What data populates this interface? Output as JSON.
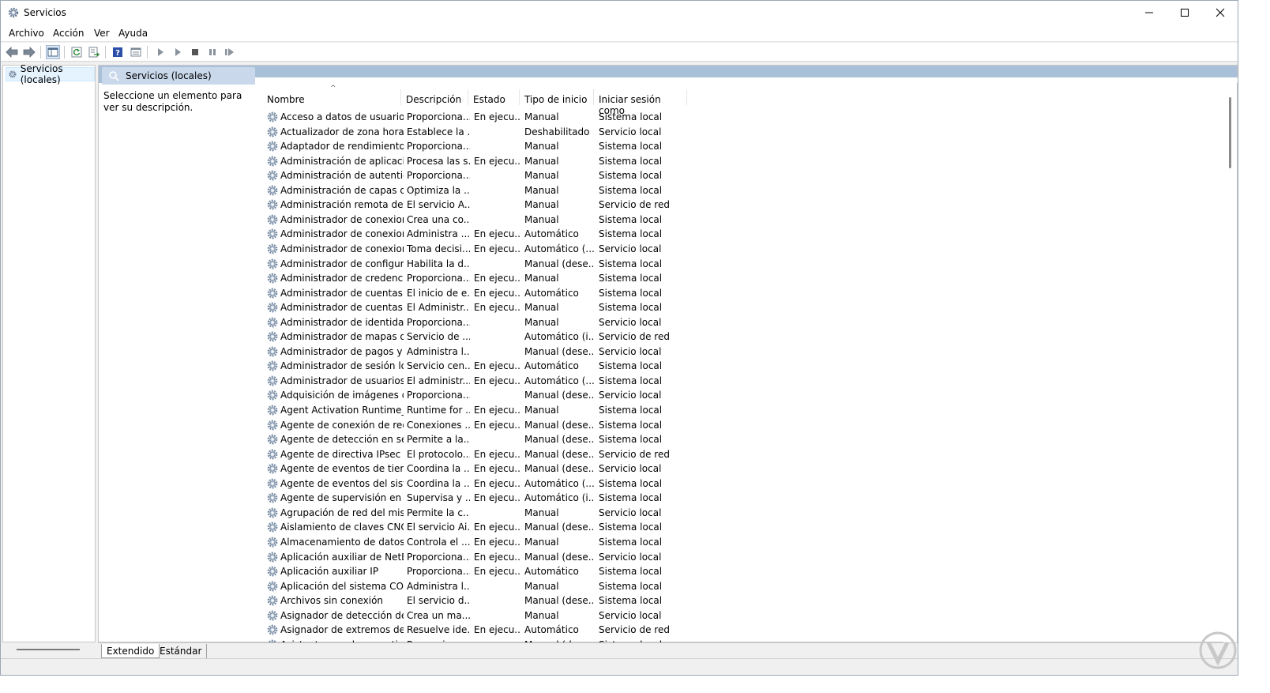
{
  "window": {
    "title": "Servicios"
  },
  "menu": [
    "Archivo",
    "Acción",
    "Ver",
    "Ayuda"
  ],
  "toolbar": {
    "icons": [
      "back-arrow-icon",
      "forward-arrow-icon",
      "show-hide-console-tree-icon",
      "refresh-icon",
      "export-list-icon",
      "help-icon",
      "properties-icon",
      "start-service-icon",
      "start-service-alt-icon",
      "stop-service-icon",
      "pause-service-icon",
      "restart-service-icon"
    ]
  },
  "tree": {
    "root_label": "Servicios (locales)"
  },
  "panel": {
    "header_label": "Servicios (locales)",
    "description": "Seleccione un elemento para ver su descripción."
  },
  "columns": [
    "Nombre",
    "Descripción",
    "Estado",
    "Tipo de inicio",
    "Iniciar sesión como"
  ],
  "rows": [
    [
      "Acceso a datos de usuarios_...",
      "Proporciona...",
      "En ejecu...",
      "Manual",
      "Sistema local"
    ],
    [
      "Actualizador de zona horari...",
      "Establece la ...",
      "",
      "Deshabilitado",
      "Servicio local"
    ],
    [
      "Adaptador de rendimiento ...",
      "Proporciona...",
      "",
      "Manual",
      "Sistema local"
    ],
    [
      "Administración de aplicacio...",
      "Procesa las s...",
      "En ejecu...",
      "Manual",
      "Sistema local"
    ],
    [
      "Administración de autentic...",
      "Proporciona...",
      "",
      "Manual",
      "Sistema local"
    ],
    [
      "Administración de capas de...",
      "Optimiza la ...",
      "",
      "Manual",
      "Sistema local"
    ],
    [
      "Administración remota de ...",
      "El servicio A...",
      "",
      "Manual",
      "Servicio de red"
    ],
    [
      "Administrador de conexion...",
      "Crea una co...",
      "",
      "Manual",
      "Sistema local"
    ],
    [
      "Administrador de conexion...",
      "Administra ...",
      "En ejecu...",
      "Automático",
      "Sistema local"
    ],
    [
      "Administrador de conexion...",
      "Toma decisi...",
      "En ejecu...",
      "Automático (...",
      "Servicio local"
    ],
    [
      "Administrador de configura...",
      "Habilita la d...",
      "",
      "Manual (dese...",
      "Sistema local"
    ],
    [
      "Administrador de credencia...",
      "Proporciona...",
      "En ejecu...",
      "Manual",
      "Sistema local"
    ],
    [
      "Administrador de cuentas d...",
      "El inicio de e...",
      "En ejecu...",
      "Automático",
      "Sistema local"
    ],
    [
      "Administrador de cuentas ...",
      "El Administr...",
      "En ejecu...",
      "Manual",
      "Sistema local"
    ],
    [
      "Administrador de identidad...",
      "Proporciona...",
      "",
      "Manual",
      "Servicio local"
    ],
    [
      "Administrador de mapas de...",
      "Servicio de ...",
      "",
      "Automático (i...",
      "Servicio de red"
    ],
    [
      "Administrador de pagos y ...",
      "Administra l...",
      "",
      "Manual (dese...",
      "Servicio local"
    ],
    [
      "Administrador de sesión local",
      "Servicio cen...",
      "En ejecu...",
      "Automático",
      "Sistema local"
    ],
    [
      "Administrador de usuarios",
      "El administr...",
      "En ejecu...",
      "Automático (...",
      "Sistema local"
    ],
    [
      "Adquisición de imágenes d...",
      "Proporciona...",
      "",
      "Manual (dese...",
      "Servicio local"
    ],
    [
      "Agent Activation Runtime_...",
      "Runtime for ...",
      "En ejecu...",
      "Manual",
      "Sistema local"
    ],
    [
      "Agente de conexión de red",
      "Conexiones ...",
      "En ejecu...",
      "Manual (dese...",
      "Sistema local"
    ],
    [
      "Agente de detección en seg...",
      "Permite a la...",
      "",
      "Manual (dese...",
      "Sistema local"
    ],
    [
      "Agente de directiva IPsec",
      "El protocolo...",
      "En ejecu...",
      "Manual (dese...",
      "Servicio de red"
    ],
    [
      "Agente de eventos de tiempo",
      "Coordina la ...",
      "En ejecu...",
      "Manual (dese...",
      "Servicio local"
    ],
    [
      "Agente de eventos del siste...",
      "Coordina la ...",
      "En ejecu...",
      "Automático (...",
      "Sistema local"
    ],
    [
      "Agente de supervisión en ti...",
      "Supervisa y ...",
      "En ejecu...",
      "Automático (i...",
      "Sistema local"
    ],
    [
      "Agrupación de red del mis...",
      "Permite la c...",
      "",
      "Manual",
      "Servicio local"
    ],
    [
      "Aislamiento de claves CNG",
      "El servicio Ai...",
      "En ejecu...",
      "Manual (dese...",
      "Sistema local"
    ],
    [
      "Almacenamiento de datos ...",
      "Controla el ...",
      "En ejecu...",
      "Manual",
      "Sistema local"
    ],
    [
      "Aplicación auxiliar de NetBI...",
      "Proporciona...",
      "En ejecu...",
      "Manual (dese...",
      "Servicio local"
    ],
    [
      "Aplicación auxiliar IP",
      "Proporciona...",
      "En ejecu...",
      "Automático",
      "Sistema local"
    ],
    [
      "Aplicación del sistema CO...",
      "Administra l...",
      "",
      "Manual",
      "Sistema local"
    ],
    [
      "Archivos sin conexión",
      "El servicio d...",
      "",
      "Manual (dese...",
      "Sistema local"
    ],
    [
      "Asignador de detección de ...",
      "Crea un ma...",
      "",
      "Manual",
      "Servicio local"
    ],
    [
      "Asignador de extremos de ...",
      "Resuelve ide...",
      "En ejecu...",
      "Automático",
      "Servicio de red"
    ],
    [
      "Asistente para la conectivid...",
      "Proporciona...",
      "",
      "Manual (dese...",
      "Sistema local"
    ]
  ],
  "bottom_tabs": [
    "Extendido",
    "Estándar"
  ]
}
